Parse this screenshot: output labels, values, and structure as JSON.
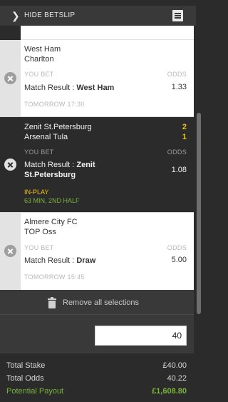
{
  "header": {
    "hide_label": "HIDE BETSLIP",
    "chevron": "chevron-right-icon",
    "betslip_icon": "receipt-icon"
  },
  "selections": [
    {
      "home": "West Ham",
      "away": "Charlton",
      "you_bet": "YOU BET",
      "odds_label": "ODDS",
      "market": "Match Result : ",
      "pick": "West Ham",
      "odds": "1.33",
      "time": "TOMORROW 17:30"
    },
    {
      "home": "Zenit St.Petersburg",
      "away": "Arsenal Tula",
      "home_score": "2",
      "away_score": "1",
      "you_bet": "YOU BET",
      "odds_label": "ODDS",
      "market": "Match Result : ",
      "pick": "Zenit St.Petersburg",
      "odds": "1.08",
      "status": "IN-PLAY",
      "minute": "63 MIN, 2ND HALF"
    },
    {
      "home": "Almere City FC",
      "away": "TOP Oss",
      "you_bet": "YOU BET",
      "odds_label": "ODDS",
      "market": "Match Result : ",
      "pick": "Draw",
      "odds": "5.00",
      "time": "TOMORROW 15:45"
    }
  ],
  "remove_all": {
    "label": "Remove all selections",
    "icon": "trash-icon"
  },
  "stake": {
    "value": "40"
  },
  "totals": {
    "stake_label": "Total Stake",
    "stake_value": "£40.00",
    "odds_label": "Total Odds",
    "odds_value": "40.22",
    "payout_label": "Potential Payout",
    "payout_value": "£1,608.80"
  },
  "colors": {
    "accent_yellow": "#f1c40f",
    "accent_green": "#78b43c",
    "dark_bg": "#2b2b2b",
    "bar_bg": "#393939"
  }
}
